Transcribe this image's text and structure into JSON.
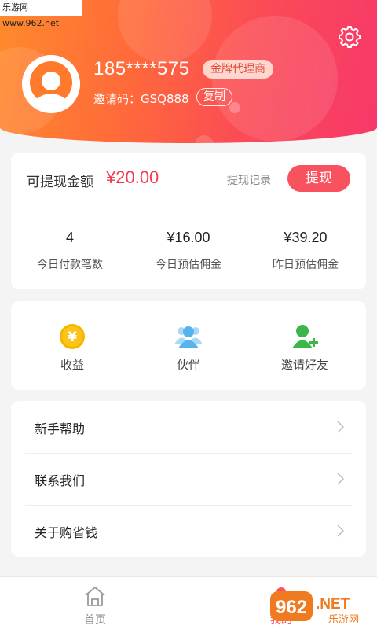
{
  "watermark": "乐游网 www.962.net",
  "profile": {
    "phone": "185****575",
    "badge": "金牌代理商",
    "invite_label": "邀请码：GSQ888",
    "copy_label": "复制"
  },
  "balance": {
    "label": "可提现金额",
    "value": "¥20.00",
    "record_link": "提现记录",
    "withdraw_label": "提现"
  },
  "stats": [
    {
      "value": "4",
      "label": "今日付款笔数"
    },
    {
      "value": "¥16.00",
      "label": "今日预估佣金"
    },
    {
      "value": "¥39.20",
      "label": "昨日预估佣金"
    }
  ],
  "menu": [
    {
      "label": "收益",
      "icon": "yuan-coin-icon",
      "color": "#f5b400"
    },
    {
      "label": "伙伴",
      "icon": "partners-icon",
      "color": "#5ab7ee"
    },
    {
      "label": "邀请好友",
      "icon": "add-friend-icon",
      "color": "#3cb64a"
    }
  ],
  "list": [
    {
      "label": "新手帮助"
    },
    {
      "label": "联系我们"
    },
    {
      "label": "关于购省钱"
    }
  ],
  "tabs": [
    {
      "label": "首页",
      "icon": "home-icon",
      "active": false
    },
    {
      "label": "我的",
      "icon": "user-icon",
      "active": true
    }
  ],
  "logo": {
    "text_main": "962",
    "text_net": ".NET",
    "text_sub": "乐游网"
  },
  "colors": {
    "accent": "#f8525f",
    "header_start": "#ff8a2c",
    "header_end": "#f7386a"
  }
}
